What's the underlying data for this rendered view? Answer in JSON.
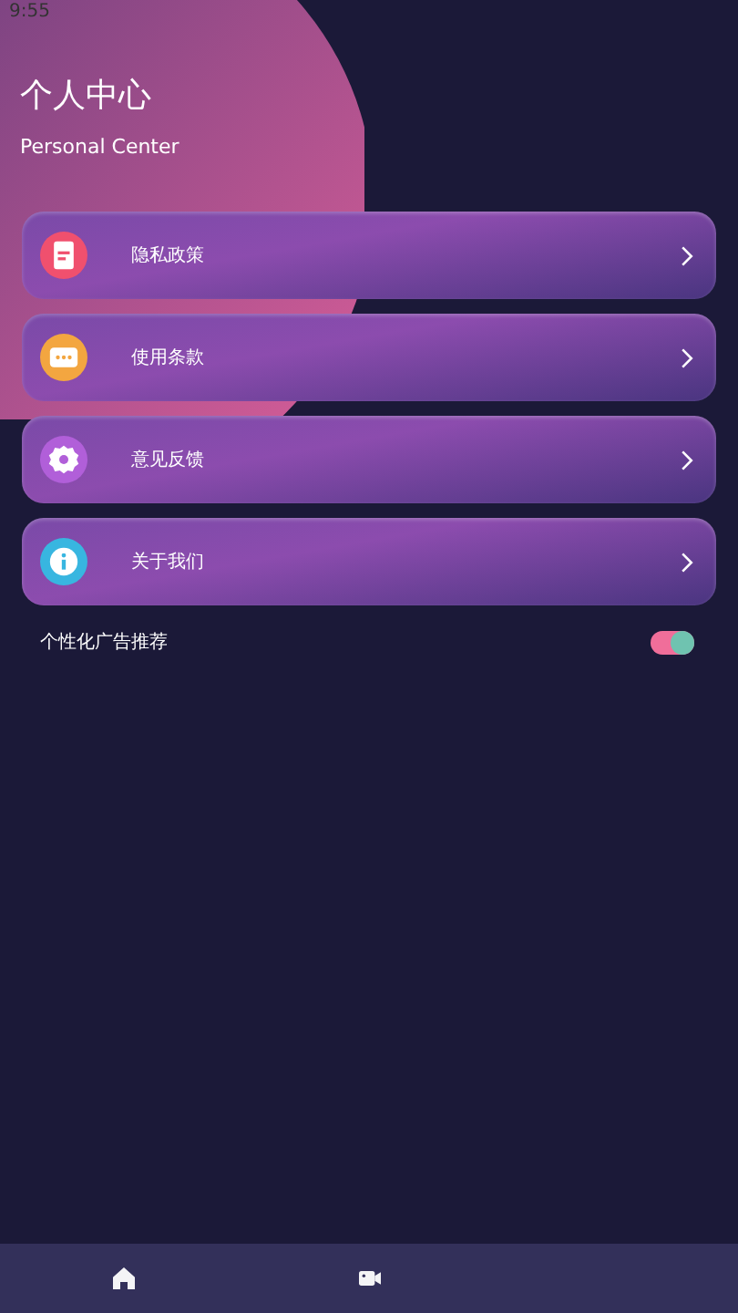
{
  "status_bar": {
    "time": "9:55"
  },
  "header": {
    "title": "个人中心",
    "subtitle": "Personal Center"
  },
  "menu": [
    {
      "kind": "document",
      "label": "隐私政策",
      "color": "#f0506e"
    },
    {
      "kind": "chat",
      "label": "使用条款",
      "color": "#f3a640"
    },
    {
      "kind": "gear",
      "label": "意见反馈",
      "color": "#b15fd9"
    },
    {
      "kind": "info",
      "label": "关于我们",
      "color": "#38b6e0"
    }
  ],
  "setting": {
    "label": "个性化广告推荐",
    "on": true
  },
  "nav": [
    {
      "kind": "home",
      "selected": false
    },
    {
      "kind": "video",
      "selected": false
    }
  ]
}
